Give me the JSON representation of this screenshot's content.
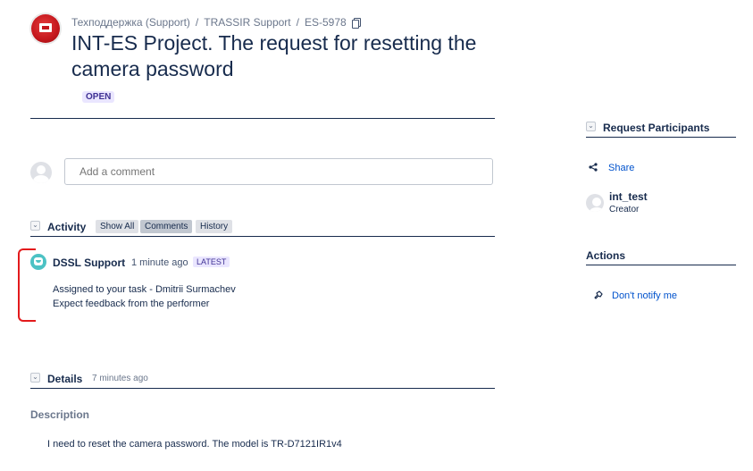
{
  "breadcrumb": {
    "project": "Техподдержка (Support)",
    "portal": "TRASSIR Support",
    "issue_key": "ES-5978"
  },
  "issue": {
    "title": "INT-ES Project. The request for resetting the camera password",
    "status": "OPEN"
  },
  "comment": {
    "placeholder": "Add a comment"
  },
  "activity": {
    "title": "Activity",
    "tabs": [
      "Show All",
      "Comments",
      "History"
    ],
    "entries": [
      {
        "author": "DSSL Support",
        "time": "1 minute ago",
        "badge": "LATEST",
        "lines": [
          "Assigned to your task - Dmitrii Surmachev",
          "Expect feedback from the performer"
        ]
      }
    ]
  },
  "details": {
    "title": "Details",
    "time": "7 minutes ago",
    "description_label": "Description",
    "description_text": "I need to reset the camera password. The model is TR-D7121IR1v4"
  },
  "sidebar": {
    "participants_title": "Request Participants",
    "share_label": "Share",
    "participant": {
      "name": "int_test",
      "role": "Creator"
    },
    "actions_title": "Actions",
    "dont_notify_label": "Don't notify me"
  },
  "colors": {
    "link": "#0052cc",
    "badge_bg": "#eae6ff",
    "annotation": "#e31a1c"
  }
}
